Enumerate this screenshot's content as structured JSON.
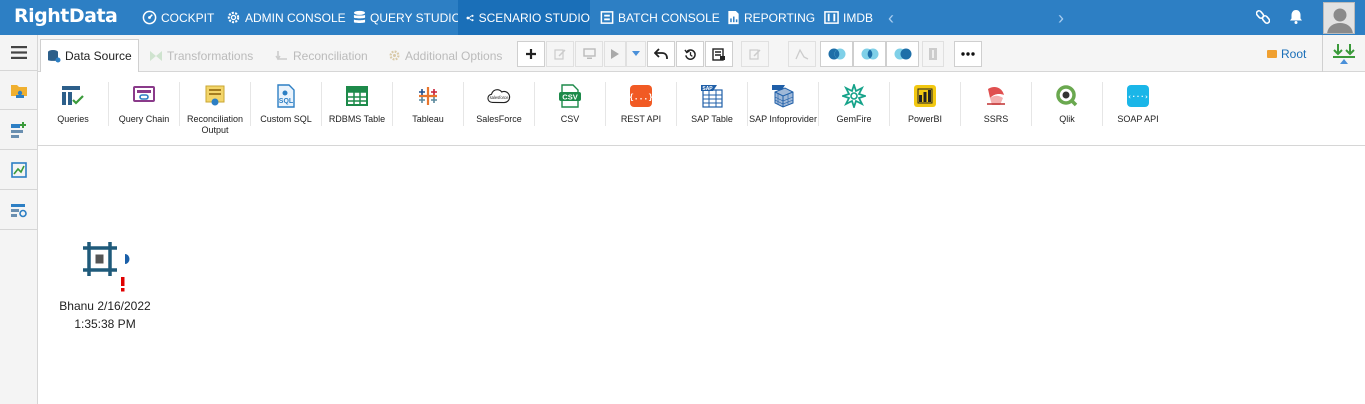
{
  "brand": {
    "name": "RightData"
  },
  "nav": {
    "items": [
      {
        "label": "COCKPIT",
        "icon": "cockpit-icon"
      },
      {
        "label": "ADMIN CONSOLE",
        "icon": "gear-icon"
      },
      {
        "label": "QUERY STUDIO",
        "icon": "database-icon"
      },
      {
        "label": "SCENARIO STUDIO",
        "icon": "scenario-icon",
        "active": true
      },
      {
        "label": "BATCH CONSOLE",
        "icon": "batch-icon"
      },
      {
        "label": "REPORTING",
        "icon": "report-icon"
      },
      {
        "label": "IMDB",
        "icon": "imdb-icon"
      }
    ]
  },
  "tabs": [
    {
      "label": "Data Source",
      "active": true
    },
    {
      "label": "Transformations"
    },
    {
      "label": "Reconciliation"
    },
    {
      "label": "Additional Options"
    }
  ],
  "toolbar": {
    "root_label": "Root"
  },
  "sources": [
    {
      "label": "Queries"
    },
    {
      "label": "Query Chain"
    },
    {
      "label": "Reconciliation Output"
    },
    {
      "label": "Custom SQL"
    },
    {
      "label": "RDBMS Table"
    },
    {
      "label": "Tableau"
    },
    {
      "label": "SalesForce"
    },
    {
      "label": "CSV"
    },
    {
      "label": "REST API"
    },
    {
      "label": "SAP Table"
    },
    {
      "label": "SAP Infoprovider"
    },
    {
      "label": "GemFire"
    },
    {
      "label": "PowerBI"
    },
    {
      "label": "SSRS"
    },
    {
      "label": "Qlik"
    },
    {
      "label": "SOAP API"
    }
  ],
  "source_icon_text": {
    "sql": "SQL",
    "csv": "CSV",
    "sap": "SAP",
    "rest": "{...}",
    "soap": "‹···›",
    "salesforce": "salesforce"
  },
  "canvas": {
    "node": {
      "label_line1": "Bhanu 2/16/2022",
      "label_line2": "1:35:38 PM"
    }
  },
  "colors": {
    "accent": "#2d7fc4",
    "active_nav": "#1a6fb8",
    "warning": "#e00000"
  }
}
